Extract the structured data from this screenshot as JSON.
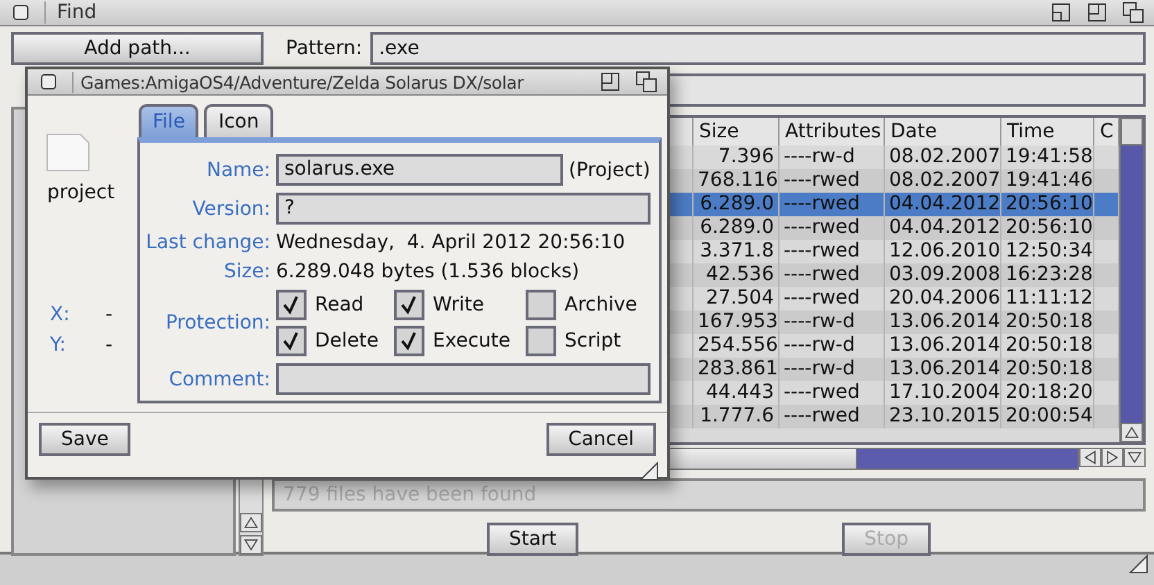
{
  "window": {
    "title": "Find"
  },
  "add_path_button": "Add path...",
  "pattern": {
    "label": "Pattern:",
    "value": ".exe"
  },
  "table": {
    "columns": [
      "Size",
      "Attributes",
      "Date",
      "Time",
      "C"
    ],
    "rows": [
      {
        "size": "7.396",
        "attributes": "----rw-d",
        "date": "08.02.2007",
        "time": "19:41:58",
        "selected": false
      },
      {
        "size": "768.116",
        "attributes": "----rwed",
        "date": "08.02.2007",
        "time": "19:41:46",
        "selected": false
      },
      {
        "size": "6.289.0",
        "attributes": "----rwed",
        "date": "04.04.2012",
        "time": "20:56:10",
        "selected": true
      },
      {
        "size": "6.289.0",
        "attributes": "----rwed",
        "date": "04.04.2012",
        "time": "20:56:10",
        "selected": false
      },
      {
        "size": "3.371.8",
        "attributes": "----rwed",
        "date": "12.06.2010",
        "time": "12:50:34",
        "selected": false
      },
      {
        "size": "42.536",
        "attributes": "----rwed",
        "date": "03.09.2008",
        "time": "16:23:28",
        "selected": false
      },
      {
        "size": "27.504",
        "attributes": "----rwed",
        "date": "20.04.2006",
        "time": "11:11:12",
        "selected": false
      },
      {
        "size": "167.953",
        "attributes": "----rw-d",
        "date": "13.06.2014",
        "time": "20:50:18",
        "selected": false
      },
      {
        "size": "254.556",
        "attributes": "----rw-d",
        "date": "13.06.2014",
        "time": "20:50:18",
        "selected": false
      },
      {
        "size": "283.861",
        "attributes": "----rw-d",
        "date": "13.06.2014",
        "time": "20:50:18",
        "selected": false
      },
      {
        "size": "44.443",
        "attributes": "----rwed",
        "date": "17.10.2004",
        "time": "20:18:20",
        "selected": false
      },
      {
        "size": "1.777.6",
        "attributes": "----rwed",
        "date": "23.10.2015",
        "time": "20:00:54",
        "selected": false
      }
    ]
  },
  "status": "779 files have been found",
  "buttons": [
    {
      "label": "Start",
      "disabled": false
    },
    {
      "label": "Stop",
      "disabled": true
    }
  ],
  "dialog": {
    "title": "Games:AmigaOS4/Adventure/Zelda Solarus DX/solar",
    "icon_type": "project",
    "position": [
      {
        "label": "X:",
        "value": "-"
      },
      {
        "label": "Y:",
        "value": "-"
      }
    ],
    "tabs": [
      {
        "label": "File",
        "selected": true
      },
      {
        "label": "Icon",
        "selected": false
      }
    ],
    "name": {
      "label": "Name:",
      "value": "solarus.exe",
      "type": "(Project)"
    },
    "version": {
      "label": "Version:",
      "value": "?"
    },
    "last_change": {
      "label": "Last change:",
      "value": "Wednesday,  4. April 2012 20:56:10"
    },
    "size": {
      "label": "Size:",
      "value": "6.289.048 bytes (1.536 blocks)"
    },
    "protection": {
      "label": "Protection:",
      "flags": [
        {
          "label": "Read",
          "checked": true
        },
        {
          "label": "Write",
          "checked": true
        },
        {
          "label": "Archive",
          "checked": false
        },
        {
          "label": "Delete",
          "checked": true
        },
        {
          "label": "Execute",
          "checked": true
        },
        {
          "label": "Script",
          "checked": false
        }
      ]
    },
    "comment": {
      "label": "Comment:"
    },
    "buttons": [
      "Save",
      "Cancel"
    ]
  }
}
